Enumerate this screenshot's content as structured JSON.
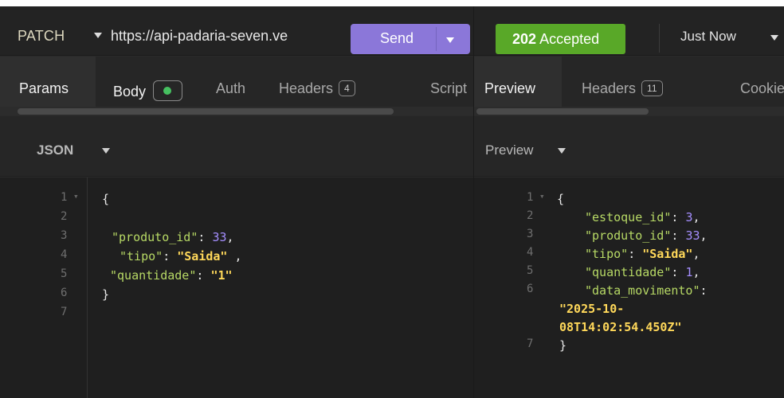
{
  "request": {
    "method": "PATCH",
    "url": "https://api-padaria-seven.ve",
    "send_label": "Send",
    "tabs": [
      {
        "label": "Params"
      },
      {
        "label": "Body"
      },
      {
        "label": "Auth"
      },
      {
        "label": "Headers",
        "count": "4"
      },
      {
        "label": "Script"
      }
    ],
    "body_format": "JSON",
    "body_lines": [
      {
        "num": "1",
        "text": "{"
      },
      {
        "num": "2",
        "text": ""
      },
      {
        "num": "3",
        "key": "\"produto_id\"",
        "value": "33",
        "value_type": "number",
        "tail": ","
      },
      {
        "num": "4",
        "key": "\"tipo\"",
        "value": "\"Saida\"",
        "value_type": "string",
        "tail": " ,"
      },
      {
        "num": "5",
        "key": "\"quantidade\"",
        "value": "\"1\"",
        "value_type": "string",
        "tail": ""
      },
      {
        "num": "6",
        "text": "}"
      },
      {
        "num": "7",
        "text": ""
      }
    ]
  },
  "response": {
    "status_code": "202",
    "status_text": "Accepted",
    "time_label": "Just Now",
    "tabs": [
      {
        "label": "Preview"
      },
      {
        "label": "Headers",
        "count": "11"
      },
      {
        "label": "Cookie"
      }
    ],
    "preview_label": "Preview",
    "preview_lines": [
      {
        "num": "1",
        "text": "{"
      },
      {
        "num": "2",
        "key": "\"estoque_id\"",
        "value": "3",
        "value_type": "number",
        "tail": ","
      },
      {
        "num": "3",
        "key": "\"produto_id\"",
        "value": "33",
        "value_type": "number",
        "tail": ","
      },
      {
        "num": "4",
        "key": "\"tipo\"",
        "value": "\"Saida\"",
        "value_type": "string",
        "tail": ","
      },
      {
        "num": "5",
        "key": "\"quantidade\"",
        "value": "1",
        "value_type": "number",
        "tail": ","
      },
      {
        "num": "6",
        "key": "\"data_movimento\"",
        "tail": ":"
      },
      {
        "num": "",
        "value": "\"2025-10-",
        "value_type": "string"
      },
      {
        "num": "",
        "value": "08T14:02:54.450Z\"",
        "value_type": "string"
      },
      {
        "num": "7",
        "text": "}"
      }
    ]
  },
  "colors": {
    "accent_send": "#8b77d9",
    "status_ok": "#59a828",
    "json_key": "#b7d965",
    "json_string": "#ffd85a",
    "json_number": "#a58eff"
  }
}
